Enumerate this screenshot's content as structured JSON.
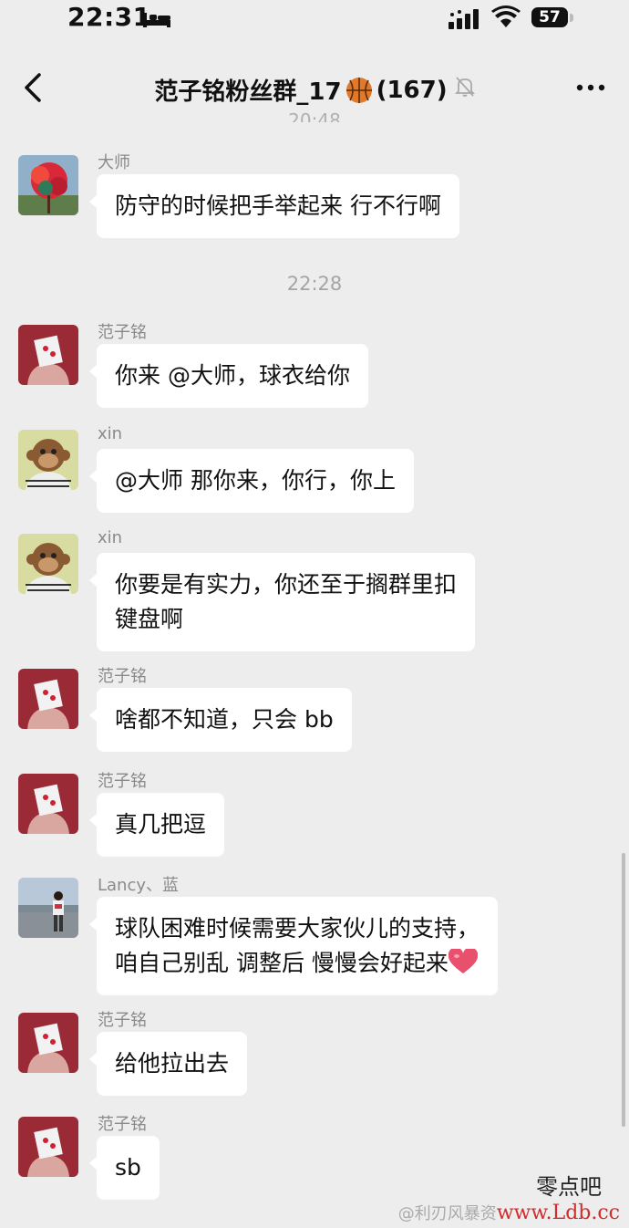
{
  "status_bar": {
    "time": "22:31",
    "battery": "57"
  },
  "nav": {
    "title_prefix": "范子铭粉丝群_17",
    "title_suffix": "(167)"
  },
  "previous_time_partial": "20:48",
  "messages": [
    {
      "type": "msg",
      "sender": "大师",
      "avatar": "red-tree",
      "lines": [
        "防守的时候把手举起来 行不行啊"
      ]
    },
    {
      "type": "time",
      "text": "22:28"
    },
    {
      "type": "msg",
      "sender": "范子铭",
      "avatar": "mask-person",
      "lines": [
        "你来 @大师，球衣给你"
      ]
    },
    {
      "type": "msg",
      "sender": "xin",
      "avatar": "ape",
      "lines": [
        "@大师 那你来，你行，你上"
      ]
    },
    {
      "type": "msg",
      "sender": "xin",
      "avatar": "ape",
      "lines": [
        "你要是有实力，你还至于搁群里扣",
        "键盘啊"
      ]
    },
    {
      "type": "msg",
      "sender": "范子铭",
      "avatar": "mask-person",
      "lines": [
        "啥都不知道，只会 bb"
      ]
    },
    {
      "type": "msg",
      "sender": "范子铭",
      "avatar": "mask-person",
      "lines": [
        "真几把逗"
      ]
    },
    {
      "type": "msg",
      "sender": "Lancy、蓝",
      "avatar": "photo-person",
      "lines": [
        "球队困难时候需要大家伙儿的支持，",
        "咱自己别乱 调整后 慢慢会好起来"
      ],
      "emoji": "heart"
    },
    {
      "type": "msg",
      "sender": "范子铭",
      "avatar": "mask-person",
      "lines": [
        "给他拉出去"
      ]
    },
    {
      "type": "msg",
      "sender": "范子铭",
      "avatar": "mask-person",
      "lines": [
        "sb"
      ]
    }
  ],
  "watermark": {
    "line1": "零点吧",
    "line2_prefix": "@利刃风暴资",
    "line2_site": "www.Ldb.cc"
  },
  "colors": {
    "background": "#ededed",
    "bubble": "#ffffff",
    "heart": "#e8506e"
  }
}
